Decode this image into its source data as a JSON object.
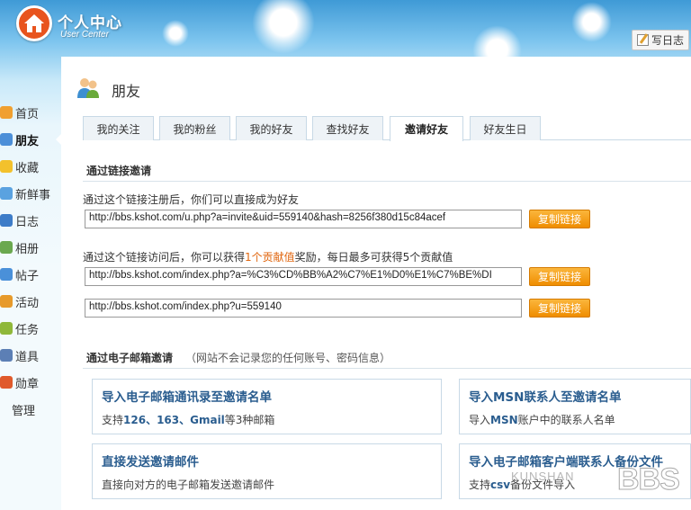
{
  "header": {
    "logo_cn": "个人中心",
    "logo_en": "User Center",
    "write_blog_label": "写日志"
  },
  "nav": {
    "items": [
      {
        "label": "首页",
        "icon": "home-icon",
        "color": "#f0a030"
      },
      {
        "label": "朋友",
        "icon": "friends-icon",
        "color": "#4c8fd8"
      },
      {
        "label": "收藏",
        "icon": "star-icon",
        "color": "#f3c12c"
      },
      {
        "label": "新鲜事",
        "icon": "speech-bubble-icon",
        "color": "#5aa2e0"
      },
      {
        "label": "日志",
        "icon": "blog-icon",
        "color": "#3d7cc8"
      },
      {
        "label": "相册",
        "icon": "album-icon",
        "color": "#6aa84f"
      },
      {
        "label": "帖子",
        "icon": "post-icon",
        "color": "#4a90d9"
      },
      {
        "label": "活动",
        "icon": "event-icon",
        "color": "#e79a2b"
      },
      {
        "label": "任务",
        "icon": "task-icon",
        "color": "#8fb83a"
      },
      {
        "label": "道具",
        "icon": "tool-icon",
        "color": "#5c7fb5"
      },
      {
        "label": "勋章",
        "icon": "medal-icon",
        "color": "#e05a2b"
      }
    ],
    "manage_label": "管理"
  },
  "page": {
    "title": "朋友"
  },
  "tabs": [
    {
      "label": "我的关注"
    },
    {
      "label": "我的粉丝"
    },
    {
      "label": "我的好友"
    },
    {
      "label": "查找好友"
    },
    {
      "label": "邀请好友"
    },
    {
      "label": "好友生日"
    }
  ],
  "link_invite": {
    "heading": "通过链接邀请",
    "desc1": "通过这个链接注册后，你们可以直接成为好友",
    "url1": "http://bbs.kshot.com/u.php?a=invite&uid=559140&hash=8256f380d15c84acef",
    "desc2_a": "通过这个链接访问后，你可以获得",
    "desc2_hl": "1个贡献值",
    "desc2_b": "奖励，每日最多可获得5个贡献值",
    "url2": "http://bbs.kshot.com/index.php?a=%C3%CD%BB%A2%C7%E1%D0%E1%C7%BE%DI",
    "url3": "http://bbs.kshot.com/index.php?u=559140",
    "copy_label": "复制链接"
  },
  "email_invite": {
    "heading": "通过电子邮箱邀请",
    "note": "（网站不会记录您的任何账号、密码信息）",
    "cards": [
      {
        "title": "导入电子邮箱通讯录至邀请名单",
        "sub_a": "支持",
        "sub_b": "126、163、Gmail",
        "sub_c": "等3种邮箱"
      },
      {
        "title": "导入MSN联系人至邀请名单",
        "sub_a": "导入",
        "sub_b": "MSN",
        "sub_c": "账户中的联系人名单"
      },
      {
        "title": "直接发送邀请邮件",
        "sub_a": "直接向对方的电子邮箱发送邀请邮件",
        "sub_b": "",
        "sub_c": ""
      },
      {
        "title": "导入电子邮箱客户端联系人备份文件",
        "sub_a": "支持",
        "sub_b": "csv",
        "sub_c": "备份文件导入"
      }
    ]
  },
  "watermark": {
    "small": "KUNSHAN",
    "big": "BBS"
  }
}
